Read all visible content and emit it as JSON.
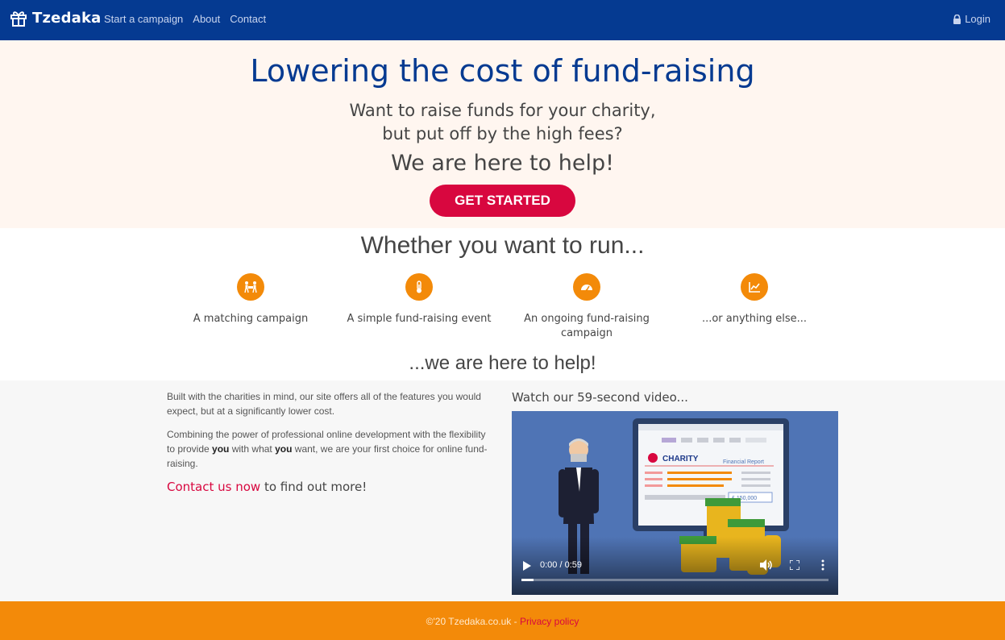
{
  "navbar": {
    "brand": "Tzedaka",
    "brand_icon": "gift-icon",
    "links": [
      "Start a campaign",
      "About",
      "Contact"
    ],
    "login": "Login",
    "login_icon": "lock-icon",
    "color": "#053a91"
  },
  "hero": {
    "title": "Lowering the cost of fund-raising",
    "subtitle_line1": "Want to raise funds for your charity,",
    "subtitle_line2": "but put off by the high fees?",
    "help": "We are here to help!",
    "cta": "GET STARTED",
    "cta_color": "#d8073f"
  },
  "features": {
    "title": "Whether you want to run...",
    "items": [
      {
        "label": "A matching campaign",
        "icon": "people-handshake-icon"
      },
      {
        "label": "A simple fund-raising event",
        "icon": "thermometer-icon"
      },
      {
        "label": "An ongoing fund-raising campaign",
        "icon": "gauge-icon"
      },
      {
        "label": "...or anything else...",
        "icon": "line-chart-icon"
      }
    ],
    "help": "...we are here to help!",
    "icon_color": "#f38a09"
  },
  "info": {
    "p1": "Built with the charities in mind, our site offers all of the features you would expect, but at a significantly lower cost.",
    "p2_a": "Combining the power of professional online development with the flexibility to provide ",
    "p2_you1": "you",
    "p2_b": " with what ",
    "p2_you2": "you",
    "p2_c": " want, we are your first choice for online fund-raising.",
    "contact_link": "Contact us now",
    "contact_rest": " to find out more!",
    "video_title": "Watch our 59-second video...",
    "video": {
      "time": "0:00 / 0:59",
      "progress": 0.04,
      "screen_brand": "CHARITY",
      "screen_report": "Financial Report",
      "screen_amount": "£ 150,000"
    }
  },
  "footer": {
    "text": "©'20 Tzedaka.co.uk - ",
    "link": "Privacy policy",
    "color": "#f38a09"
  }
}
